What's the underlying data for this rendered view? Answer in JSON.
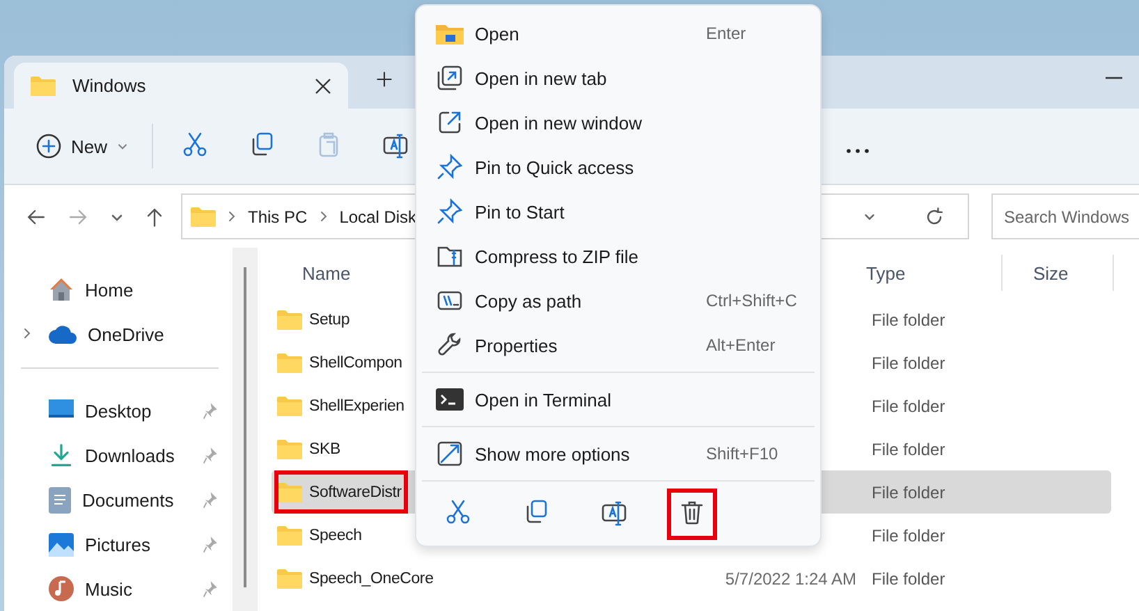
{
  "window": {
    "tabs": [
      {
        "label": "Windows",
        "selected": true
      }
    ]
  },
  "toolbar": {
    "new_label": "New",
    "items": [
      {
        "disabled": false
      },
      {
        "disabled": false
      },
      {
        "disabled": true
      },
      {
        "disabled": false
      }
    ]
  },
  "address_bar": {
    "crumbs": [
      "This PC",
      "Local Disk"
    ]
  },
  "search": {
    "placeholder": "Search Windows"
  },
  "sidebar": {
    "items": [
      {
        "label": "Home",
        "pinned": false,
        "expandable": false
      },
      {
        "label": "OneDrive",
        "pinned": false,
        "expandable": true
      },
      {
        "label": "Desktop",
        "pinned": true,
        "expandable": false
      },
      {
        "label": "Downloads",
        "pinned": true,
        "expandable": false
      },
      {
        "label": "Documents",
        "pinned": true,
        "expandable": false
      },
      {
        "label": "Pictures",
        "pinned": true,
        "expandable": false
      },
      {
        "label": "Music",
        "pinned": true,
        "expandable": false
      }
    ]
  },
  "table": {
    "columns": [
      "Name",
      "Type",
      "Size"
    ],
    "rows": [
      {
        "name": "Setup",
        "type": "File folder",
        "selected": false,
        "outlined": false
      },
      {
        "name": "ShellCompon",
        "type": "File folder",
        "selected": false,
        "outlined": false
      },
      {
        "name": "ShellExperien",
        "type": "File folder",
        "selected": false,
        "outlined": false
      },
      {
        "name": "SKB",
        "type": "File folder",
        "selected": false,
        "outlined": false
      },
      {
        "name": "SoftwareDistr",
        "type": "File folder",
        "selected": true,
        "outlined": true
      },
      {
        "name": "Speech",
        "type": "File folder",
        "selected": false,
        "outlined": false
      },
      {
        "name": "Speech_OneCore",
        "date": "5/7/2022 1:24 AM",
        "type": "File folder",
        "selected": false,
        "outlined": false
      }
    ]
  },
  "context_menu": {
    "groups": [
      [
        {
          "label": "Open",
          "shortcut": "Enter"
        },
        {
          "label": "Open in new tab"
        },
        {
          "label": "Open in new window"
        },
        {
          "label": "Pin to Quick access"
        },
        {
          "label": "Pin to Start"
        },
        {
          "label": "Compress to ZIP file"
        },
        {
          "label": "Copy as path",
          "shortcut": "Ctrl+Shift+C"
        },
        {
          "label": "Properties",
          "shortcut": "Alt+Enter"
        }
      ],
      [
        {
          "label": "Open in Terminal"
        }
      ],
      [
        {
          "label": "Show more options",
          "shortcut": "Shift+F10"
        }
      ]
    ],
    "actions": [
      {
        "outlined": false
      },
      {
        "outlined": false
      },
      {
        "outlined": false
      },
      {
        "outlined": true
      }
    ]
  }
}
